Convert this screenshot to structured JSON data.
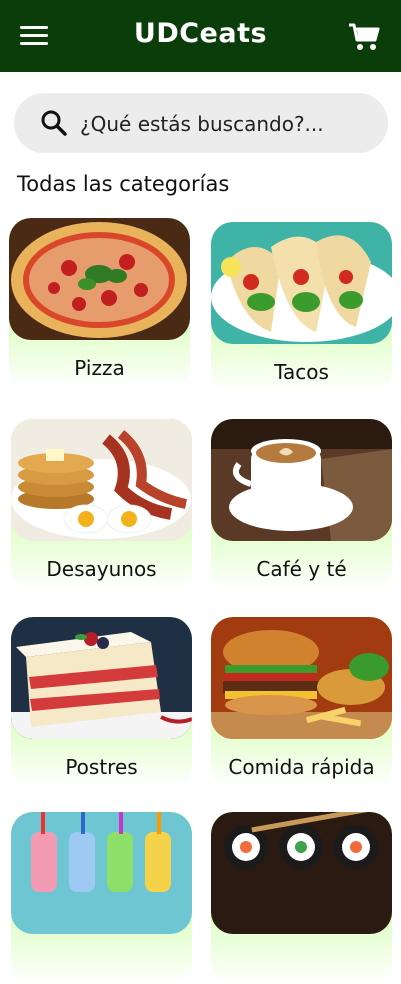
{
  "app": {
    "title": "UDCeats"
  },
  "search": {
    "placeholder": "¿Qué estás buscando?..."
  },
  "section": {
    "title": "Todas las categorías"
  },
  "categories": [
    {
      "label": "Pizza"
    },
    {
      "label": "Tacos"
    },
    {
      "label": "Desayunos"
    },
    {
      "label": "Café y té"
    },
    {
      "label": "Postres"
    },
    {
      "label": "Comida rápida"
    },
    {
      "label": ""
    },
    {
      "label": ""
    }
  ],
  "colors": {
    "header": "#0b3d0b",
    "accent": "#8aff3a"
  }
}
